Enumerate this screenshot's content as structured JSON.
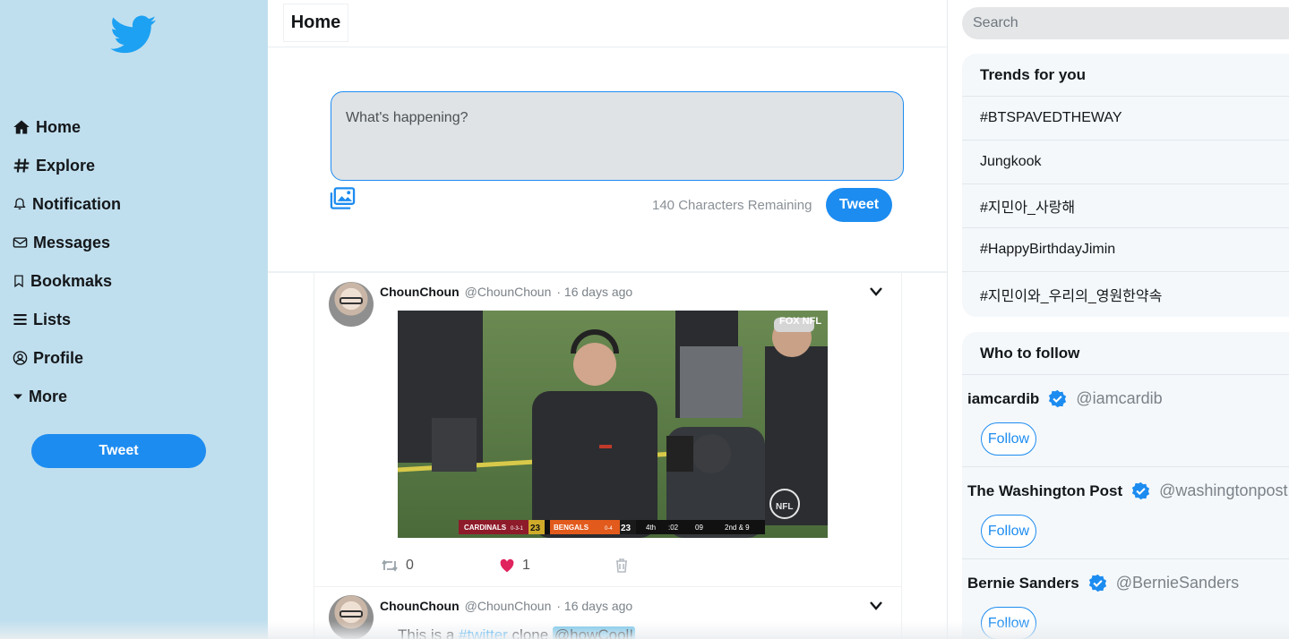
{
  "sidebar": {
    "nav": [
      {
        "label": "Home",
        "icon": "home-icon"
      },
      {
        "label": "Explore",
        "icon": "hash-icon"
      },
      {
        "label": "Notification",
        "icon": "bell-icon"
      },
      {
        "label": "Messages",
        "icon": "envelope-icon"
      },
      {
        "label": "Bookmaks",
        "icon": "bookmark-icon"
      },
      {
        "label": "Lists",
        "icon": "list-icon"
      },
      {
        "label": "Profile",
        "icon": "user-circle-icon"
      },
      {
        "label": "More",
        "icon": "caret-down-icon"
      }
    ],
    "tweet_label": "Tweet"
  },
  "main": {
    "title": "Home",
    "compose": {
      "placeholder": "What's happening?",
      "remaining": "140 Characters Remaining",
      "tweet_label": "Tweet"
    },
    "tweets": [
      {
        "name": "ChounChoun",
        "handle": "@ChounChoun",
        "time": "· 16 days ago",
        "retweets": "0",
        "likes": "1",
        "image_caption": "FOX NFL",
        "score": {
          "team1": "CARDINALS",
          "rec1": "0-3-1",
          "s1": "23",
          "team2": "BENGALS",
          "rec2": "0-4",
          "s2": "23",
          "qtr": "4th",
          "clock": ":02",
          "play": "09",
          "down": "2nd & 9"
        }
      },
      {
        "name": "ChounChoun",
        "handle": "@ChounChoun",
        "time": "· 16 days ago",
        "text_before": "This is a ",
        "hashtag": "#twitter",
        "text_mid": " clone ",
        "mention": "@howCool!"
      }
    ]
  },
  "right": {
    "search_placeholder": "Search",
    "trends_title": "Trends for you",
    "trends": [
      "#BTSPAVEDTHEWAY",
      "Jungkook",
      "#지민아_사랑해",
      "#HappyBirthdayJimin",
      "#지민이와_우리의_영원한약속"
    ],
    "follow_title": "Who to follow",
    "follow": [
      {
        "name": "iamcardib",
        "handle": "@iamcardib",
        "button": "Follow"
      },
      {
        "name": "The Washington Post",
        "handle": "@washingtonpost",
        "button": "Follow"
      },
      {
        "name": "Bernie Sanders",
        "handle": "@BernieSanders",
        "button": "Follow"
      }
    ]
  },
  "colors": {
    "accent": "#1d8cf0",
    "sidebar_bg": "#c0dfee",
    "like": "#e0245e"
  }
}
